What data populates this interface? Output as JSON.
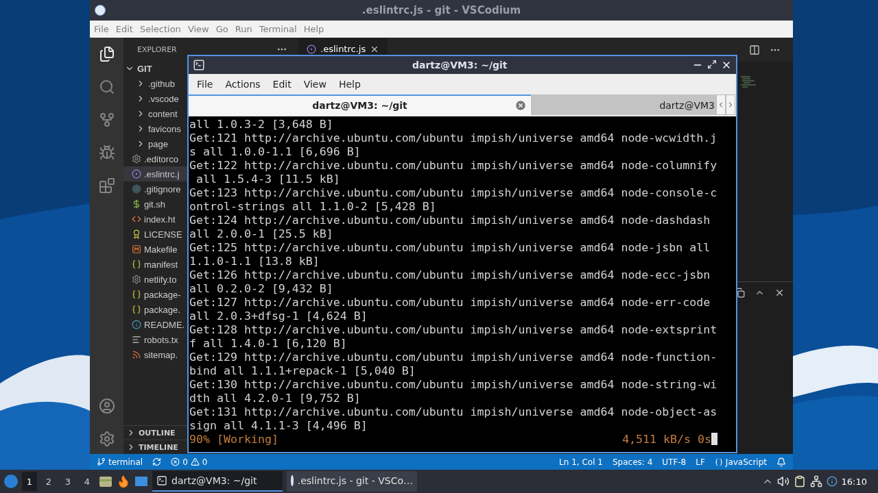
{
  "vscodium": {
    "title": ".eslintrc.js - git - VSCodium",
    "menu": [
      "File",
      "Edit",
      "Selection",
      "View",
      "Go",
      "Run",
      "Terminal",
      "Help"
    ],
    "explorer": {
      "header": "EXPLORER",
      "root": "GIT",
      "expanded": true,
      "items": [
        {
          "name": ".github",
          "kind": "folder",
          "selected": false
        },
        {
          "name": ".vscode",
          "kind": "folder",
          "selected": false
        },
        {
          "name": "content",
          "kind": "folder",
          "selected": false
        },
        {
          "name": "favicons",
          "kind": "folder",
          "selected": false
        },
        {
          "name": "page",
          "kind": "folder",
          "selected": false
        },
        {
          "name": ".editorco",
          "kind": "config",
          "selected": false
        },
        {
          "name": ".eslintrc.j",
          "kind": "eslint",
          "selected": true
        },
        {
          "name": ".gitignore",
          "kind": "git",
          "selected": false
        },
        {
          "name": "git.sh",
          "kind": "shell",
          "selected": false
        },
        {
          "name": "index.ht",
          "kind": "html",
          "selected": false
        },
        {
          "name": "LICENSE",
          "kind": "license",
          "selected": false
        },
        {
          "name": "Makefile",
          "kind": "make",
          "selected": false
        },
        {
          "name": "manifest",
          "kind": "json",
          "selected": false
        },
        {
          "name": "netlify.to",
          "kind": "config",
          "selected": false
        },
        {
          "name": "package-",
          "kind": "json",
          "selected": false
        },
        {
          "name": "package.",
          "kind": "json",
          "selected": false
        },
        {
          "name": "README.",
          "kind": "info",
          "selected": false
        },
        {
          "name": "robots.tx",
          "kind": "text",
          "selected": false
        },
        {
          "name": "sitemap.",
          "kind": "rss",
          "selected": false
        }
      ],
      "sections": [
        {
          "label": "OUTLINE",
          "expanded": false
        },
        {
          "label": "TIMELINE",
          "expanded": false
        }
      ]
    },
    "tabs": [
      {
        "label": ".eslintrc.js",
        "selected": true
      }
    ],
    "status_bar": {
      "branch": "terminal",
      "errors": "0",
      "warnings": "0",
      "items": [
        "Ln 1, Col 1",
        "Spaces: 4",
        "UTF-8",
        "LF"
      ],
      "language": "JavaScript"
    }
  },
  "terminal_window": {
    "title": "dartz@VM3: ~/git",
    "menu": [
      "File",
      "Actions",
      "Edit",
      "View",
      "Help"
    ],
    "tabs": [
      {
        "label": "dartz@VM3: ~/git",
        "selected": true
      },
      {
        "label": "dartz@VM3",
        "selected": false
      }
    ],
    "lines": [
      "all 1.0.3-2 [3,648 B]",
      "Get:121 http://archive.ubuntu.com/ubuntu impish/universe amd64 node-wcwidth.j",
      "s all 1.0.0-1.1 [6,696 B]",
      "Get:122 http://archive.ubuntu.com/ubuntu impish/universe amd64 node-columnify",
      " all 1.5.4-3 [11.5 kB]",
      "Get:123 http://archive.ubuntu.com/ubuntu impish/universe amd64 node-console-c",
      "ontrol-strings all 1.1.0-2 [5,428 B]",
      "Get:124 http://archive.ubuntu.com/ubuntu impish/universe amd64 node-dashdash",
      "all 2.0.0-1 [25.5 kB]",
      "Get:125 http://archive.ubuntu.com/ubuntu impish/universe amd64 node-jsbn all",
      "1.1.0-1.1 [13.8 kB]",
      "Get:126 http://archive.ubuntu.com/ubuntu impish/universe amd64 node-ecc-jsbn",
      "all 0.2.0-2 [9,432 B]",
      "Get:127 http://archive.ubuntu.com/ubuntu impish/universe amd64 node-err-code",
      "all 2.0.3+dfsg-1 [4,624 B]",
      "Get:128 http://archive.ubuntu.com/ubuntu impish/universe amd64 node-extsprint",
      "f all 1.4.0-1 [6,120 B]",
      "Get:129 http://archive.ubuntu.com/ubuntu impish/universe amd64 node-function-",
      "bind all 1.1.1+repack-1 [5,040 B]",
      "Get:130 http://archive.ubuntu.com/ubuntu impish/universe amd64 node-string-wi",
      "dth all 4.2.0-1 [9,752 B]",
      "Get:131 http://archive.ubuntu.com/ubuntu impish/universe amd64 node-object-as",
      "sign all 4.1.1-3 [4,496 B]"
    ],
    "progress": "90% [Working]",
    "rate": "4,511 kB/s 0s"
  },
  "taskbar": {
    "workspaces": [
      {
        "label": "1",
        "selected": true
      },
      {
        "label": "2",
        "selected": false
      },
      {
        "label": "3",
        "selected": false
      },
      {
        "label": "4",
        "selected": false
      }
    ],
    "tasks": [
      {
        "label": "dartz@VM3: ~/git",
        "kind": "terminal",
        "selected": true
      },
      {
        "label": ".eslintrc.js - git - VSCo…",
        "kind": "editor",
        "selected": false
      }
    ],
    "clock": "16:10"
  }
}
